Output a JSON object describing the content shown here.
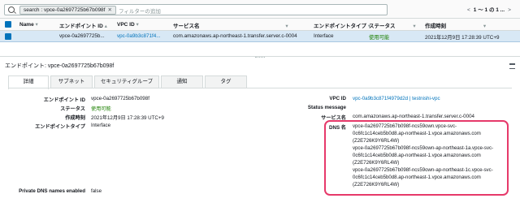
{
  "search": {
    "token_key": "search",
    "token_value": "vpce-0a2697725b67b098f",
    "placeholder": "フィルターの追加"
  },
  "pager": {
    "prev": "<",
    "text": "1 〜 1 の 1 ...",
    "next": ">"
  },
  "table": {
    "headers": [
      "Name",
      "エンドポイント ID",
      "VPC ID",
      "サービス名",
      "エンドポイントタイプ",
      "ステータス",
      "作成時刻"
    ],
    "row": {
      "name": "",
      "endpoint_id": "vpce-0a2697725b...",
      "vpc_id": "vpc-0a9b3c871f4...",
      "service": "com.amazonaws.ap-northeast-1.transfer.server.c-0004",
      "type": "Interface",
      "status": "使用可能",
      "created": "2021年12月9日 17:28:39 UTC+9"
    }
  },
  "detail_title": "エンドポイント: vpce-0a2697725b67b098f",
  "tabs": [
    "詳細",
    "サブネット",
    "セキュリティグループ",
    "通知",
    "タグ"
  ],
  "details": {
    "endpoint_id_label": "エンドポイント ID",
    "endpoint_id": "vpce-0a2697725b67b098f",
    "status_label": "ステータス",
    "status": "使用可能",
    "created_label": "作成時刻",
    "created": "2021年12月9日 17:28:39 UTC+9",
    "type_label": "エンドポイントタイプ",
    "type": "Interface",
    "vpc_label": "VPC ID",
    "vpc": "vpc-0a9b3c871f4979d2d | testnishi-vpc",
    "status_msg_label": "Status message",
    "service_label": "サービス名",
    "service": "com.amazonaws.ap-northeast-1.transfer.server.c-0004",
    "dns_label": "DNS 名",
    "dns_lines": [
      "vpce-0a2697725b67b098f-ncs59own.vpce-svc-",
      "0c6fc1c14ceb5b0d8.ap-northeast-1.vpce.amazonaws.com",
      "(Z2E726K9Y6RL4W)",
      "vpce-0a2697725b67b098f-ncs59own-ap-northeast-1a.vpce-svc-",
      "0c6fc1c14ceb5b0d8.ap-northeast-1.vpce.amazonaws.com",
      "(Z2E726K9Y6RL4W)",
      "vpce-0a2697725b67b098f-ncs59own-ap-northeast-1c.vpce-svc-",
      "0c6fc1c14ceb5b0d8.ap-northeast-1.vpce.amazonaws.com",
      "(Z2E726K9Y6RL4W)"
    ],
    "private_dns_label": "Private DNS names enabled",
    "private_dns": "false"
  },
  "colors": {
    "link": "#0073bb",
    "available": "#1d8102",
    "selected_row": "#d8e8f5",
    "highlight": "#e6396a"
  }
}
